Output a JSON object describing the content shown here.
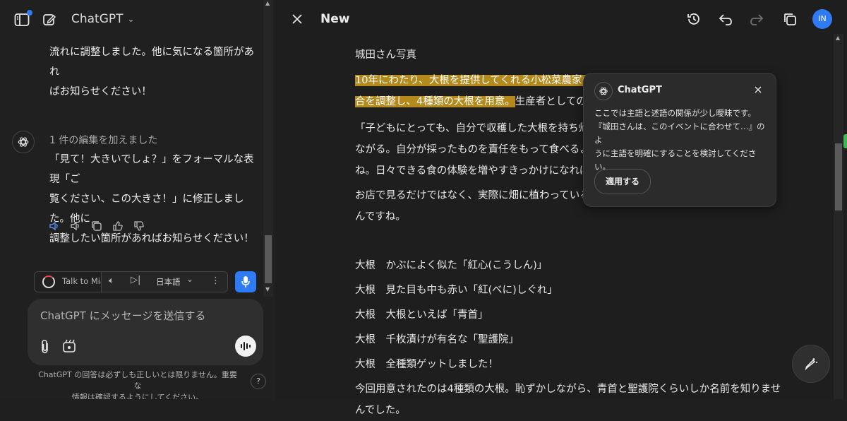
{
  "app": {
    "title": "ChatGPT"
  },
  "chat": {
    "prev_message": [
      "流れに調整しました。他に気になる箇所があれ",
      "ばお知らせください！"
    ],
    "edit_status": "1 件の編集を加えました",
    "message": [
      "「見て！大きいでしょ？」をフォーマルな表現「ご",
      "覧ください、この大きさ！」に修正しました。他に",
      "調整したい箇所があればお知らせください！"
    ]
  },
  "voice": {
    "talk_label": "Talk to Mia",
    "language": "日本語"
  },
  "composer": {
    "placeholder": "ChatGPT にメッセージを送信する",
    "disclaimer": [
      "ChatGPT の回答は必ずしも正しいとは限りません。重要な",
      "情報は確認するようにしてください。"
    ],
    "help": "?"
  },
  "canvas": {
    "title": "New"
  },
  "avatar": {
    "initials": "IN"
  },
  "document": {
    "line1": "城田さん写真",
    "hl1": "10年にわたり、大根を提供してくれる小松菜農家の城",
    "hl2": "合を調整し、4種類の大根を用意。",
    "hl2_rest": "生産者としての思",
    "p2": [
      "「子どもにとっても、自分で収穫した大根を持ち帰り、料",
      "ながる。自分が採ったものを責任をもって食べるようにな",
      "ね。日々できる食の体験を増やすきっかけになればと続"
    ],
    "p3": [
      "お店で見るだけではなく、実際に畑に植わっている大根",
      "んですね。"
    ],
    "items": [
      "大根　かぶによく似た「紅心(こうしん)」",
      "大根　見た目も中も赤い「紅(べに)しぐれ」",
      "大根　大根といえば「青首」",
      "大根　千枚漬けが有名な「聖護院」",
      "大根　全種類ゲットしました！"
    ],
    "last": [
      "今回用意されたのは4種類の大根。恥ずかしながら、青首と聖護院くらいしか名前を知りませ",
      "んでした。"
    ]
  },
  "popup": {
    "title": "ChatGPT",
    "body": [
      "ここでは主語と述語の関係が少し曖昧です。",
      "『城田さんは、このイベントに合わせて…』のよ",
      "うに主語を明確にすることを検討してくださ",
      "い。"
    ],
    "apply": "適用する"
  }
}
